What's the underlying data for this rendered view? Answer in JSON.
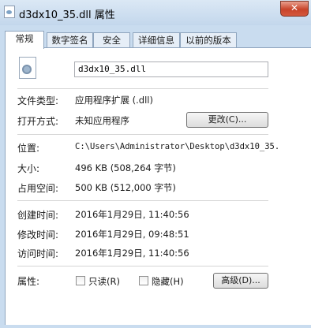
{
  "window": {
    "title": "d3dx10_35.dll 属性",
    "close_glyph": "✕"
  },
  "tabs": [
    {
      "label": "常规",
      "active": true
    },
    {
      "label": "数字签名",
      "active": false
    },
    {
      "label": "安全",
      "active": false
    },
    {
      "label": "详细信息",
      "active": false
    },
    {
      "label": "以前的版本",
      "active": false
    }
  ],
  "file": {
    "name": "d3dx10_35.dll",
    "icon": "dll-file-icon"
  },
  "labels": {
    "type": "文件类型:",
    "opens_with": "打开方式:",
    "location": "位置:",
    "size": "大小:",
    "size_on_disk": "占用空间:",
    "created": "创建时间:",
    "modified": "修改时间:",
    "accessed": "访问时间:",
    "attributes": "属性:"
  },
  "values": {
    "type": "应用程序扩展 (.dll)",
    "opens_with": "未知应用程序",
    "location": "C:\\Users\\Administrator\\Desktop\\d3dx10_35.",
    "size": "496 KB (508,264 字节)",
    "size_on_disk": "500 KB (512,000 字节)",
    "created": "2016年1月29日, 11:40:56",
    "modified": "2016年1月29日, 09:48:51",
    "accessed": "2016年1月29日, 11:40:56"
  },
  "buttons": {
    "change": "更改(C)...",
    "advanced": "高级(D)..."
  },
  "attributes": {
    "readonly": {
      "label": "只读(R)",
      "checked": false
    },
    "hidden": {
      "label": "隐藏(H)",
      "checked": false
    }
  },
  "colors": {
    "titlebar": "#c3d7ec",
    "close_button": "#c8442a",
    "panel": "#ffffff"
  }
}
